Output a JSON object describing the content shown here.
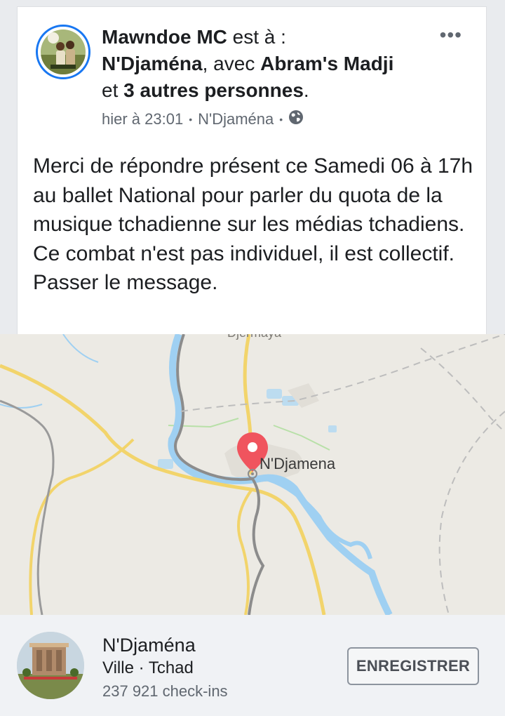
{
  "post": {
    "author": "Mawndoe MC",
    "is_at": " est à :",
    "location": "N'Djaména",
    "with_text": ", avec ",
    "tagged": "Abram's Madji",
    "and_text": "et ",
    "others": "3 autres personnes",
    "period": ".",
    "time": "hier à 23:01",
    "sep": "•",
    "meta_location": "N'Djaména",
    "privacy_icon": "globe-icon",
    "more_label": "•••",
    "body": "Merci de répondre présent ce Samedi 06 à 17h au ballet National pour parler du quota de la musique tchadienne sur les médias tchadiens.\nCe combat n'est pas individuel, il est collectif. Passer le message."
  },
  "map": {
    "city_label": "N'Djamena",
    "top_label": "Djermaya",
    "pin_color": "#f0545e",
    "road_color": "#f2d46b",
    "river_color": "#9fd0f2",
    "border_color": "#8c8c8c"
  },
  "place": {
    "name": "N'Djaména",
    "category": "Ville · Tchad",
    "checkins": "237 921 check-ins",
    "save_label": "ENREGISTRER"
  },
  "colors": {
    "accent": "#1877f2",
    "text_primary": "#1c1e21",
    "text_secondary": "#606770"
  }
}
